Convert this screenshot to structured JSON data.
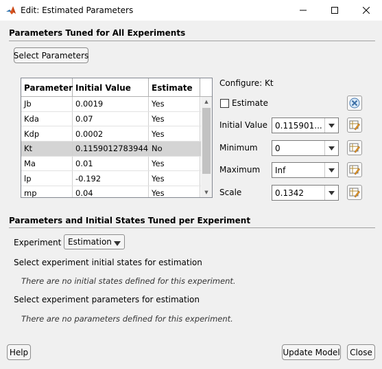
{
  "window": {
    "title": "Edit: Estimated Parameters"
  },
  "section_all": {
    "header": "Parameters Tuned for All Experiments",
    "select_button": "Select Parameters",
    "table": {
      "columns": [
        "Parameter",
        "Initial Value",
        "Estimate"
      ],
      "rows": [
        {
          "parameter": "Jb",
          "initial_value": "0.0019",
          "estimate": "Yes"
        },
        {
          "parameter": "Kda",
          "initial_value": "0.07",
          "estimate": "Yes"
        },
        {
          "parameter": "Kdp",
          "initial_value": "0.0002",
          "estimate": "Yes"
        },
        {
          "parameter": "Kt",
          "initial_value": "0.115901278394452",
          "estimate": "No"
        },
        {
          "parameter": "Ma",
          "initial_value": "0.01",
          "estimate": "Yes"
        },
        {
          "parameter": "lp",
          "initial_value": "-0.192",
          "estimate": "Yes"
        },
        {
          "parameter": "mp",
          "initial_value": "0.04",
          "estimate": "Yes"
        }
      ],
      "selected_row": 3
    }
  },
  "configure": {
    "title": "Configure: Kt",
    "estimate_label": "Estimate",
    "estimate_checked": false,
    "initial_value_label": "Initial Value",
    "initial_value": "0.115901...",
    "minimum_label": "Minimum",
    "minimum": "0",
    "maximum_label": "Maximum",
    "maximum": "Inf",
    "scale_label": "Scale",
    "scale": "0.1342"
  },
  "section_per_experiment": {
    "header": "Parameters and Initial States Tuned per Experiment",
    "experiment_label": "Experiment",
    "experiment_value": "Estimation",
    "initial_states_label": "Select experiment initial states for estimation",
    "initial_states_note": "There are no initial states defined for this experiment.",
    "parameters_label": "Select experiment parameters for estimation",
    "parameters_note": "There are no parameters defined for this experiment."
  },
  "footer": {
    "help": "Help",
    "update_model": "Update Model",
    "close": "Close"
  }
}
